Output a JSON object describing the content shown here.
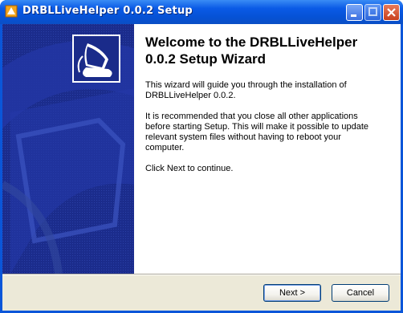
{
  "window": {
    "title": "DRBLLiveHelper 0.0.2 Setup",
    "icons": {
      "app": "installer-icon",
      "minimize": "minimize-icon",
      "maximize": "maximize-icon",
      "close": "close-icon"
    }
  },
  "sidebar": {
    "image": "installer-welcome-graphic"
  },
  "content": {
    "heading": "Welcome to the DRBLLiveHelper 0.0.2 Setup Wizard",
    "paragraph1": "This wizard will guide you through the installation of DRBLLiveHelper 0.0.2.",
    "paragraph2": "It is recommended that you close all other applications before starting Setup. This will make it possible to update relevant system files without having to reboot your computer.",
    "paragraph3": "Click Next to continue."
  },
  "buttons": {
    "next": "Next >",
    "cancel": "Cancel"
  },
  "colors": {
    "titlebar": "#0a5ae6",
    "sidebar": "#1a2b8a",
    "dialog_bg": "#ece9d8"
  }
}
